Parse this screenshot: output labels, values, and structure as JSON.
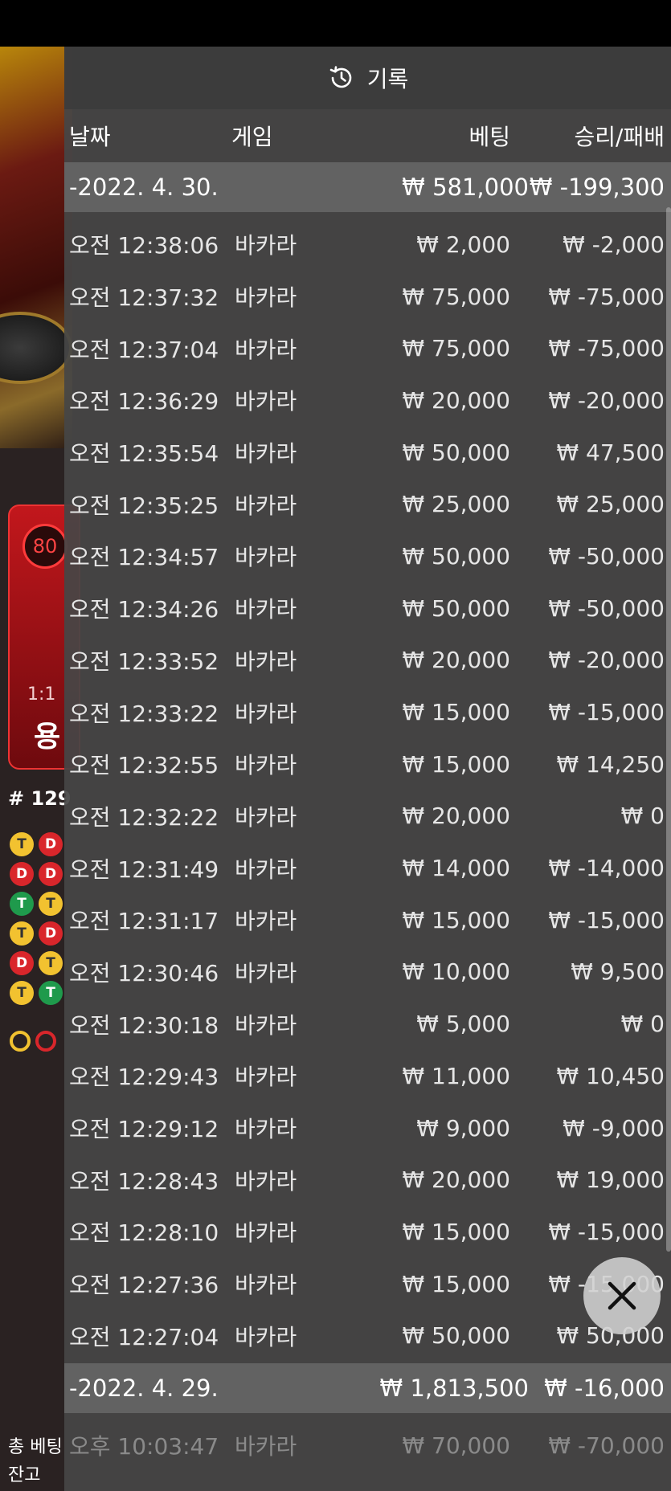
{
  "header": {
    "title": "기록",
    "icon": "history-icon"
  },
  "columns": {
    "date": "날짜",
    "game": "게임",
    "bet": "베팅",
    "win_loss": "승리/패배"
  },
  "groups": [
    {
      "date": "-2022. 4. 30.",
      "total_bet": "₩ 581,000",
      "total_win": "₩ -199,300",
      "rows": [
        {
          "time": "오전 12:38:06",
          "game": "바카라",
          "bet": "₩ 2,000",
          "win": "₩ -2,000"
        },
        {
          "time": "오전 12:37:32",
          "game": "바카라",
          "bet": "₩ 75,000",
          "win": "₩ -75,000"
        },
        {
          "time": "오전 12:37:04",
          "game": "바카라",
          "bet": "₩ 75,000",
          "win": "₩ -75,000"
        },
        {
          "time": "오전 12:36:29",
          "game": "바카라",
          "bet": "₩ 20,000",
          "win": "₩ -20,000"
        },
        {
          "time": "오전 12:35:54",
          "game": "바카라",
          "bet": "₩ 50,000",
          "win": "₩ 47,500"
        },
        {
          "time": "오전 12:35:25",
          "game": "바카라",
          "bet": "₩ 25,000",
          "win": "₩ 25,000"
        },
        {
          "time": "오전 12:34:57",
          "game": "바카라",
          "bet": "₩ 50,000",
          "win": "₩ -50,000"
        },
        {
          "time": "오전 12:34:26",
          "game": "바카라",
          "bet": "₩ 50,000",
          "win": "₩ -50,000"
        },
        {
          "time": "오전 12:33:52",
          "game": "바카라",
          "bet": "₩ 20,000",
          "win": "₩ -20,000"
        },
        {
          "time": "오전 12:33:22",
          "game": "바카라",
          "bet": "₩ 15,000",
          "win": "₩ -15,000"
        },
        {
          "time": "오전 12:32:55",
          "game": "바카라",
          "bet": "₩ 15,000",
          "win": "₩ 14,250"
        },
        {
          "time": "오전 12:32:22",
          "game": "바카라",
          "bet": "₩ 20,000",
          "win": "₩ 0"
        },
        {
          "time": "오전 12:31:49",
          "game": "바카라",
          "bet": "₩ 14,000",
          "win": "₩ -14,000"
        },
        {
          "time": "오전 12:31:17",
          "game": "바카라",
          "bet": "₩ 15,000",
          "win": "₩ -15,000"
        },
        {
          "time": "오전 12:30:46",
          "game": "바카라",
          "bet": "₩ 10,000",
          "win": "₩ 9,500"
        },
        {
          "time": "오전 12:30:18",
          "game": "바카라",
          "bet": "₩ 5,000",
          "win": "₩ 0"
        },
        {
          "time": "오전 12:29:43",
          "game": "바카라",
          "bet": "₩ 11,000",
          "win": "₩ 10,450"
        },
        {
          "time": "오전 12:29:12",
          "game": "바카라",
          "bet": "₩ 9,000",
          "win": "₩ -9,000"
        },
        {
          "time": "오전 12:28:43",
          "game": "바카라",
          "bet": "₩ 20,000",
          "win": "₩ 19,000"
        },
        {
          "time": "오전 12:28:10",
          "game": "바카라",
          "bet": "₩ 15,000",
          "win": "₩ -15,000"
        },
        {
          "time": "오전 12:27:36",
          "game": "바카라",
          "bet": "₩ 15,000",
          "win": "₩ -15,000"
        },
        {
          "time": "오전 12:27:04",
          "game": "바카라",
          "bet": "₩ 50,000",
          "win": "₩ 50,000"
        }
      ]
    },
    {
      "date": "-2022. 4. 29.",
      "total_bet": "₩ 1,813,500",
      "total_win": "₩ -16,000",
      "rows": [
        {
          "time": "오후 10:03:47",
          "game": "바카라",
          "bet": "₩ 70,000",
          "win": "₩ -70,000"
        }
      ]
    }
  ],
  "background": {
    "bet_number": "80",
    "bet_ratio": "1:1",
    "bet_label": "용",
    "round": "# 129",
    "bottom_label_1": "총 베팅",
    "bottom_label_2": "잔고"
  },
  "colors": {
    "panel": "#464646",
    "date_band": "#646464",
    "bet_card": "#c2171c",
    "gold": "#f2c230"
  }
}
